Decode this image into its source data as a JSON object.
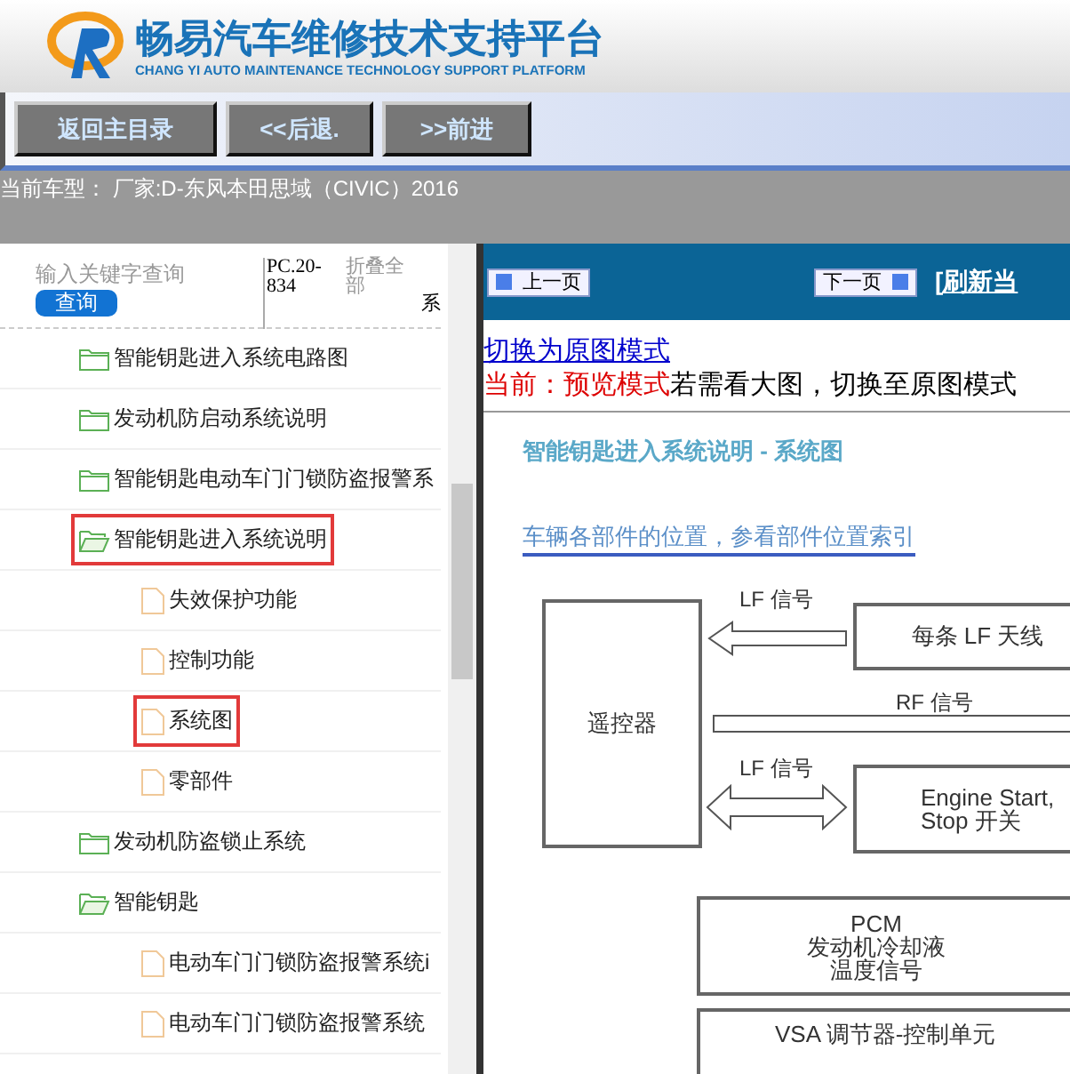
{
  "header": {
    "title": "畅易汽车维修技术支持平台",
    "subtitle": "CHANG YI AUTO MAINTENANCE TECHNOLOGY SUPPORT PLATFORM"
  },
  "toolbar": [
    "返回主目录",
    "<<后退.",
    ">>前进"
  ],
  "current_model": "当前车型： 厂家:D-东风本田思域（CIVIC）2016",
  "sidebar": {
    "search": {
      "placeholder": "输入关键字查询",
      "button": "查询"
    },
    "code": "PC.20-834",
    "collapse": "折叠全部",
    "cut_text": "系",
    "tree": [
      {
        "label": "智能钥匙进入系统电路图",
        "kind": "folder",
        "expanded": false,
        "highlighted": false
      },
      {
        "label": "发动机防启动系统说明",
        "kind": "folder",
        "expanded": false,
        "highlighted": false
      },
      {
        "label": "智能钥匙电动车门门锁防盗报警系",
        "kind": "folder",
        "expanded": false,
        "highlighted": false
      },
      {
        "label": "智能钥匙进入系统说明",
        "kind": "folder",
        "expanded": true,
        "highlighted": true,
        "children": [
          {
            "label": "失效保护功能",
            "kind": "page",
            "highlighted": false
          },
          {
            "label": "控制功能",
            "kind": "page",
            "highlighted": false
          },
          {
            "label": "系统图",
            "kind": "page",
            "highlighted": true
          },
          {
            "label": "零部件",
            "kind": "page",
            "highlighted": false
          }
        ]
      },
      {
        "label": "发动机防盗锁止系统",
        "kind": "folder",
        "expanded": false,
        "highlighted": false
      },
      {
        "label": "智能钥匙",
        "kind": "folder",
        "expanded": true,
        "highlighted": false,
        "children": [
          {
            "label": "电动车门门锁防盗报警系统i",
            "kind": "page",
            "highlighted": false
          },
          {
            "label": "电动车门门锁防盗报警系统",
            "kind": "page",
            "highlighted": false
          }
        ]
      }
    ]
  },
  "viewer": {
    "prev": "上一页",
    "next": "下一页",
    "refresh": "[刷新当",
    "mode_link": "切换为原图模式",
    "mode_label": "当前：预览模式",
    "mode_hint": "若需看大图，切换至原图模式",
    "document": {
      "title": "智能钥匙进入系统说明 - 系统图",
      "link": "车辆各部件的位置，参看部件位置索引",
      "diagram": {
        "remote": "遥控器",
        "antenna": "每条 LF 天线",
        "lf_top": "LF 信号",
        "rf": "RF 信号",
        "lf_bottom": "LF 信号",
        "engine": [
          "Engine Start,",
          "Stop 开关"
        ],
        "pcm": [
          "PCM",
          "发动机冷却液",
          "温度信号"
        ],
        "vsa": "VSA 调节器-控制单元"
      }
    }
  }
}
